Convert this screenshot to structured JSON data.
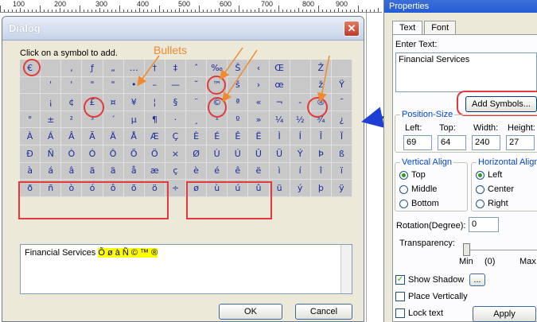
{
  "ruler": {
    "labels": [
      "100",
      "200",
      "300",
      "400",
      "500",
      "600",
      "700",
      "800",
      "900"
    ]
  },
  "dialog": {
    "title": "Dialog",
    "close_icon": "close-icon",
    "instruction": "Click on a symbol to add.",
    "symbols": [
      "€",
      "",
      "‚",
      "ƒ",
      "„",
      "…",
      "†",
      "‡",
      "ˆ",
      "‰",
      "Š",
      "‹",
      "Œ",
      "",
      "Ž",
      "",
      "",
      "'",
      "'",
      "\"",
      "\"",
      "•",
      "–",
      "—",
      "˜",
      "™",
      "š",
      "›",
      "œ",
      "",
      "ž",
      "Ÿ",
      "",
      "¡",
      "¢",
      "£",
      "¤",
      "¥",
      "¦",
      "§",
      "¨",
      "©",
      "ª",
      "«",
      "¬",
      "-",
      "®",
      "¯",
      "°",
      "±",
      "²",
      "³",
      "´",
      "µ",
      "¶",
      "·",
      "¸",
      "¹",
      "º",
      "»",
      "¼",
      "½",
      "¾",
      "¿",
      "À",
      "Á",
      "Â",
      "Ã",
      "Ä",
      "Å",
      "Æ",
      "Ç",
      "È",
      "É",
      "Ê",
      "Ë",
      "Ì",
      "Í",
      "Î",
      "Ï",
      "Ð",
      "Ñ",
      "Ò",
      "Ó",
      "Ô",
      "Õ",
      "Ö",
      "×",
      "Ø",
      "Ù",
      "Ú",
      "Û",
      "Ü",
      "Ý",
      "Þ",
      "ß",
      "à",
      "á",
      "â",
      "ã",
      "ä",
      "å",
      "æ",
      "ç",
      "è",
      "é",
      "ê",
      "ë",
      "ì",
      "í",
      "î",
      "ï",
      "ð",
      "ñ",
      "ò",
      "ó",
      "ô",
      "õ",
      "ö",
      "÷",
      "ø",
      "ù",
      "ú",
      "û",
      "ü",
      "ý",
      "þ",
      "ÿ"
    ],
    "text_plain": "Financial Services",
    "text_highlighted": "Õ  ø à Ñ © ™ ®",
    "ok_label": "OK",
    "cancel_label": "Cancel",
    "annotation_label": "Bullets",
    "colors": {
      "annotation_red": "#e23a3a",
      "annotation_orange": "#f08a2c",
      "arrow_blue": "#1e3fd6",
      "highlight": "#ffff00"
    }
  },
  "properties": {
    "title": "Properties",
    "tabs": [
      {
        "label": "Text",
        "active": true
      },
      {
        "label": "Font",
        "active": false
      }
    ],
    "enter_text_label": "Enter Text:",
    "enter_text_value": "Financial Services",
    "add_symbols_label": "Add Symbols...",
    "position_size_label": "Position-Size",
    "left_label": "Left:",
    "left_value": "69",
    "top_label": "Top:",
    "top_value": "64",
    "width_label": "Width:",
    "width_value": "240",
    "height_label": "Height:",
    "height_value": "27",
    "valign_label": "Vertical Align",
    "valign_options": [
      "Top",
      "Middle",
      "Bottom"
    ],
    "valign_selected": "Top",
    "halign_label": "Horizontal Align",
    "halign_options": [
      "Left",
      "Center",
      "Right"
    ],
    "halign_selected": "Left",
    "rotation_label": "Rotation(Degree):",
    "rotation_value": "0",
    "transparency_label": "Transparency:",
    "transparency_min": "Min",
    "transparency_value_text": "(0)",
    "transparency_max": "Max",
    "transparency_value": 0,
    "show_shadow_label": "Show Shadow",
    "show_shadow_checked": true,
    "shadow_button_label": "...",
    "place_vertically_label": "Place Vertically",
    "lock_text_label": "Lock text",
    "apply_label": "Apply"
  }
}
